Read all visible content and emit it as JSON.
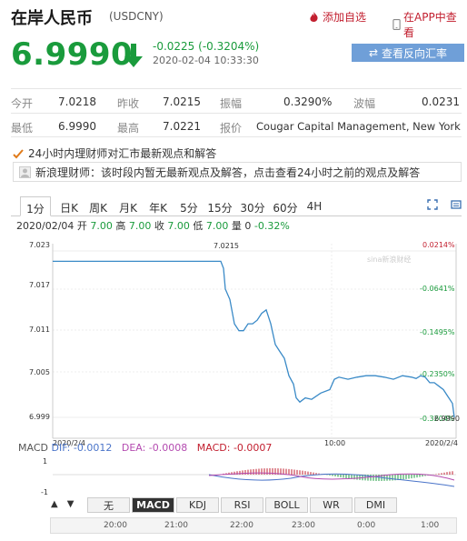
{
  "header": {
    "title": "在岸人民币",
    "code": "(USDCNY)",
    "add_watch": "添加自选",
    "app_view": "在APP中查看"
  },
  "price": {
    "current": "6.9990",
    "change": "-0.0225 (-0.3204%)",
    "timestamp": "2020-02-04 10:33:30",
    "reverse_button": "查看反向汇率"
  },
  "stats": {
    "open_label": "今开",
    "open": "7.0218",
    "prev_close_label": "昨收",
    "prev_close": "7.0215",
    "amplitude_label": "振幅",
    "amplitude": "0.3290%",
    "volatility_label": "波幅",
    "volatility": "0.0231",
    "low_label": "最低",
    "low": "6.9990",
    "high_label": "最高",
    "high": "7.0221",
    "quote_label": "报价",
    "quote_source": "Cougar Capital Management, New York"
  },
  "news": {
    "heading": "24小时内理财师对汇市最新观点和解答",
    "message": "新浪理财师：该时段内暂无最新观点及解答，点击查看24小时之前的观点及解答"
  },
  "tabs": [
    "1分",
    "日K",
    "周K",
    "月K",
    "年K",
    "5分",
    "15分",
    "30分",
    "60分",
    "4H"
  ],
  "active_tab": "1分",
  "quote_line": {
    "date": "2020/02/04",
    "open_label": "开",
    "open": "7.00",
    "high_label": "高",
    "high": "7.00",
    "close_label": "收",
    "close": "7.00",
    "low_label": "低",
    "low": "7.00",
    "volume_label": "量",
    "volume": "0",
    "pct": "-0.32%"
  },
  "chart_data": {
    "type": "line",
    "y_ticks": [
      "7.023",
      "7.017",
      "7.011",
      "7.005",
      "6.999"
    ],
    "pct_ticks": [
      "0.0214%",
      "-0.0641%",
      "-0.1495%",
      "-0.2350%",
      "-0.3204%"
    ],
    "x_ticks": [
      "2020/2/4",
      "10:00",
      "2020/2/4"
    ],
    "price_label": "7.0215",
    "last_label": "6.9990",
    "ylim": [
      6.999,
      7.023
    ],
    "x": [
      0,
      185,
      188,
      190,
      195,
      200,
      205,
      210,
      215,
      220,
      225,
      230,
      235,
      240,
      245,
      250,
      255,
      260,
      265,
      268,
      272,
      278,
      285,
      295,
      305,
      310,
      315,
      325,
      335,
      345,
      355,
      365,
      375,
      385,
      395,
      400,
      405,
      410,
      415,
      420,
      425,
      430,
      435,
      440,
      442
    ],
    "y": [
      7.0215,
      7.0215,
      7.0205,
      7.0175,
      7.016,
      7.0125,
      7.0115,
      7.0115,
      7.0125,
      7.0125,
      7.013,
      7.014,
      7.0145,
      7.0125,
      7.0095,
      7.0085,
      7.0075,
      7.005,
      7.0038,
      7.0018,
      7.0012,
      7.0018,
      7.0016,
      7.0025,
      7.003,
      7.0045,
      7.0048,
      7.0045,
      7.0048,
      7.005,
      7.005,
      7.0048,
      7.0045,
      7.005,
      7.0048,
      7.0046,
      7.005,
      7.0048,
      7.004,
      7.004,
      7.0035,
      7.003,
      7.002,
      7.001,
      6.999
    ]
  },
  "macd": {
    "label": "MACD",
    "dif": "DIF: -0.0012",
    "dea": "DEA: -0.0008",
    "macd": "MACD: -0.0007",
    "ticks": [
      "1",
      "-1"
    ]
  },
  "indicators": [
    "无",
    "MACD",
    "KDJ",
    "RSI",
    "BOLL",
    "WR",
    "DMI"
  ],
  "active_indicator": "MACD",
  "timebar": [
    "20:00",
    "21:00",
    "22:00",
    "23:00",
    "0:00",
    "1:00"
  ],
  "watermark": "sina新浪财经",
  "colors": {
    "up": "#c21f2f",
    "down": "#1a9b3c",
    "line": "#3a8ac7"
  }
}
